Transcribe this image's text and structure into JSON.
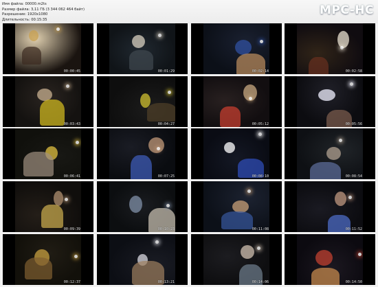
{
  "window": {
    "logo": "MPC-HC"
  },
  "file_info": {
    "lines": [
      "Имя файла: 00000.m2ts",
      "Размер файла: 3,11 ГБ (3 344 062 464 байт)",
      "Разрешение: 1920x1080",
      "Длительность: 00:15:35"
    ]
  },
  "thumbnails": [
    {
      "timestamp": "00:00:45",
      "scene": "stage-performer-hat"
    },
    {
      "timestamp": "00:01:29",
      "scene": "guitarist-closeup-blur"
    },
    {
      "timestamp": "00:02:14",
      "scene": "band-wide-stage"
    },
    {
      "timestamp": "00:02:58",
      "scene": "guitarist-long-hair"
    },
    {
      "timestamp": "00:03:43",
      "scene": "bald-bassist"
    },
    {
      "timestamp": "00:04:27",
      "scene": "yellow-guitar-closeup"
    },
    {
      "timestamp": "00:05:12",
      "scene": "guitarist-dark-shirt"
    },
    {
      "timestamp": "00:05:56",
      "scene": "guitarist-white-light"
    },
    {
      "timestamp": "00:06:41",
      "scene": "two-guitarists"
    },
    {
      "timestamp": "00:07:25",
      "scene": "singer-microphone"
    },
    {
      "timestamp": "00:08:10",
      "scene": "singer-profile-light"
    },
    {
      "timestamp": "00:08:54",
      "scene": "wide-stage-drums"
    },
    {
      "timestamp": "00:09:39",
      "scene": "bassist-closeup"
    },
    {
      "timestamp": "00:10:23",
      "scene": "drummer-stage"
    },
    {
      "timestamp": "00:11:08",
      "scene": "singer-curly-hair"
    },
    {
      "timestamp": "00:11:52",
      "scene": "guitarist-side"
    },
    {
      "timestamp": "00:12:37",
      "scene": "long-hair-closeup"
    },
    {
      "timestamp": "00:13:21",
      "scene": "saxophone-player"
    },
    {
      "timestamp": "00:14:06",
      "scene": "guitar-neck-hand"
    },
    {
      "timestamp": "00:14:50",
      "scene": "band-wide-finale"
    }
  ]
}
